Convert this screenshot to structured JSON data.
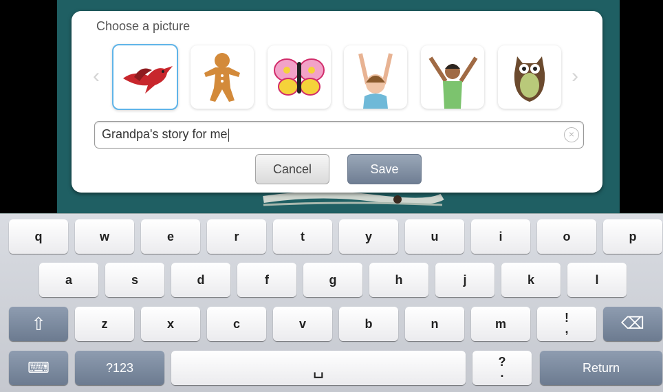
{
  "dialog": {
    "title": "Choose a picture",
    "prev_arrow": "‹",
    "next_arrow": "›",
    "pictures": [
      {
        "name": "bird"
      },
      {
        "name": "gingerbread-man"
      },
      {
        "name": "butterfly"
      },
      {
        "name": "girl"
      },
      {
        "name": "boy"
      },
      {
        "name": "owl"
      }
    ],
    "selected_index": 0,
    "title_field": {
      "value": "Grandpa's story for me"
    },
    "clear_glyph": "×",
    "cancel_label": "Cancel",
    "save_label": "Save"
  },
  "keyboard": {
    "row1": [
      "q",
      "w",
      "e",
      "r",
      "t",
      "y",
      "u",
      "i",
      "o",
      "p"
    ],
    "row2": [
      "a",
      "s",
      "d",
      "f",
      "g",
      "h",
      "j",
      "k",
      "l"
    ],
    "row3": [
      "z",
      "x",
      "c",
      "v",
      "b",
      "n",
      "m"
    ],
    "punct1_top": "!",
    "punct1_bottom": ",",
    "punct2_top": "?",
    "punct2_bottom": ".",
    "numbers_label": "?123",
    "return_label": "Return",
    "shift_icon": "⇧",
    "backspace_icon": "⌫",
    "space_icon": "␣",
    "hide_icon": "⌨"
  },
  "colors": {
    "accent": "#5fb4e8",
    "function_key": "#7b89a0",
    "dialog_bg": "#ffffff",
    "backdrop": "#1f5f63"
  }
}
